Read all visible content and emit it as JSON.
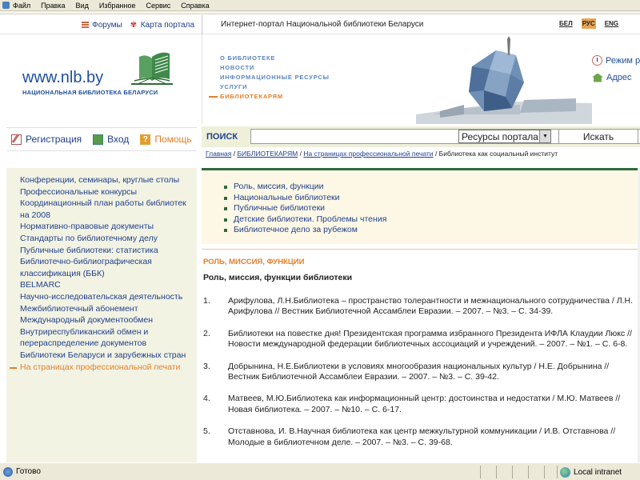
{
  "menubar": {
    "items": [
      "Файл",
      "Правка",
      "Вид",
      "Избранное",
      "Сервис",
      "Справка"
    ]
  },
  "topstrip": {
    "forums_label": "Форумы",
    "map_label": "Карта портала",
    "portal_title": "Интернет-портал Национальной библиотеки Беларуси",
    "languages": [
      {
        "code": "БЕЛ",
        "active": false
      },
      {
        "code": "РУС",
        "active": true
      },
      {
        "code": "ENG",
        "active": false
      }
    ]
  },
  "header": {
    "site_url": "www.nlb.by",
    "library_name": "НАЦИОНАЛЬНАЯ БИБЛИОТЕКА БЕЛАРУСИ",
    "nav": [
      {
        "label": "О БИБЛИОТЕКЕ",
        "active": false
      },
      {
        "label": "НОВОСТИ",
        "active": false
      },
      {
        "label": "ИНФОРМАЦИОННЫЕ РЕСУРСЫ",
        "active": false
      },
      {
        "label": "УСЛУГИ",
        "active": false
      },
      {
        "label": "БИБЛИОТЕКАРЯМ",
        "active": true
      }
    ],
    "schedule_label": "Режим р",
    "address_label": "Адрес"
  },
  "userbar": {
    "register_label": "Регистрация",
    "login_label": "Вход",
    "help_label": "Помощь"
  },
  "search": {
    "label": "ПОИСК",
    "input_value": "",
    "select_value": "Ресурсы портала",
    "button_label": "Искать"
  },
  "breadcrumb": {
    "items": [
      "Главная",
      "БИБЛИОТЕКАРЯМ",
      "На страницах профессиональной печати"
    ],
    "current": "Библиотека как социальный институт"
  },
  "leftnav": {
    "items": [
      {
        "label": "Конференции, семинары, круглые столы",
        "active": false
      },
      {
        "label": "Профессиональные конкурсы",
        "active": false
      },
      {
        "label": "Координационный план работы библиотек на 2008",
        "active": false
      },
      {
        "label": "Нормативно-правовые документы",
        "active": false
      },
      {
        "label": "Стандарты по библиотечному делу",
        "active": false
      },
      {
        "label": "Публичные библиотеки: статистика",
        "active": false
      },
      {
        "label": "Библиотечно-библиографическая классификация (ББК)",
        "active": false
      },
      {
        "label": "BELMARC",
        "active": false
      },
      {
        "label": "Научно-исследовательская деятельность",
        "active": false
      },
      {
        "label": "Межбиблиотечный абонемент",
        "active": false
      },
      {
        "label": "Международный документообмен",
        "active": false
      },
      {
        "label": "Внутриреспубликанский обмен и перераспределение документов",
        "active": false
      },
      {
        "label": "Библиотеки Беларуси и зарубежных стран",
        "active": false
      },
      {
        "label": "На страницах профессиональной печати",
        "active": true
      }
    ]
  },
  "subnav": {
    "items": [
      "Роль, миссия, функции",
      "Национальные библиотеки",
      "Публичные библиотеки",
      "Детские библиотеки. Проблемы чтения",
      "Библиотечное дело за рубежом"
    ]
  },
  "content": {
    "section_title": "РОЛЬ, МИССИЯ, ФУНКЦИИ",
    "subtitle": "Роль, миссия, функции библиотеки",
    "references": [
      {
        "num": "1.",
        "text": "Арифулова, Л.Н.Библиотека – пространство толерантности и межнационального сотрудничества / Л.Н. Арифулова // Вестник Библиотечной Ассамблеи Евразии. – 2007. – №3. – С. 34-39."
      },
      {
        "num": "2.",
        "text": "Библиотеки на повестке дня! Президентская программа избранного Президента ИФЛА Клаудии Люкс // Новости международной федерации библиотечных ассоциаций и учреждений. – 2007. – №1. – С. 6-8."
      },
      {
        "num": "3.",
        "text": "Добрынина, Н.Е.Библиотеки в условиях многообразия национальных культур / Н.Е. Добрынина // Вестник Библиотечной Ассамблеи Евразии. – 2007. – №3. – С. 39-42."
      },
      {
        "num": "4.",
        "text": "Матвеев, М.Ю.Библиотека как информационный центр: достоинства и недостатки / М.Ю. Матвеев // Новая библиотека. – 2007. – №10. – С. 6-17."
      },
      {
        "num": "5.",
        "text": "Отставнова, И. В.Научная библиотека как центр межкультурной коммуникации / И.В. Отставнова // Молодые в библиотечном деле. – 2007. – №3. – С. 39-68."
      }
    ]
  },
  "statusbar": {
    "status_text": "Готово",
    "zone_text": "Local intranet"
  }
}
